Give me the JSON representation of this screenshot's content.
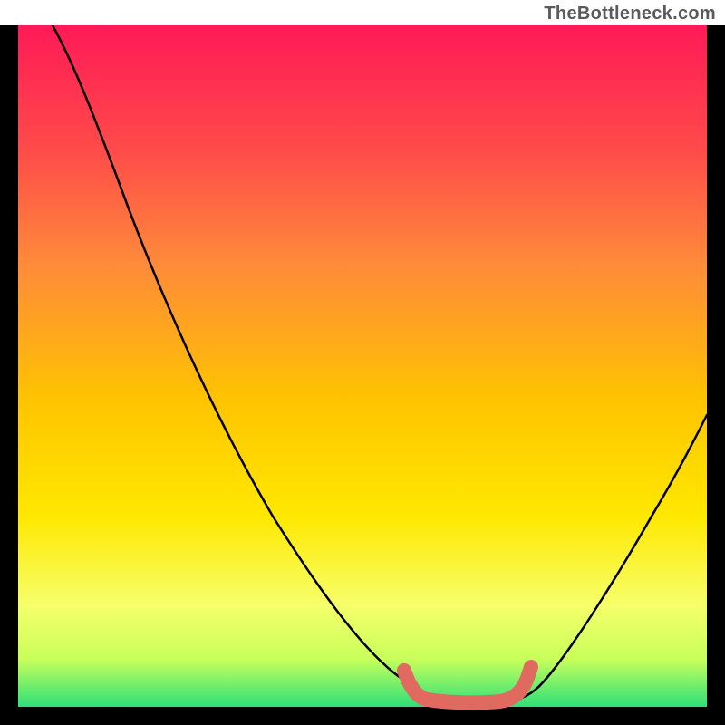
{
  "attribution": "TheBottleneck.com",
  "chart_data": {
    "type": "line",
    "title": "",
    "xlabel": "",
    "ylabel": "",
    "xlim": [
      0,
      100
    ],
    "ylim": [
      0,
      100
    ],
    "grid": false,
    "legend": false,
    "background_gradient": {
      "top_color": "#ff1a57",
      "mid_colors": [
        "#ff6b3d",
        "#ffc400",
        "#ffe800",
        "#ecff4a"
      ],
      "bottom_color": "#2de07a"
    },
    "series": [
      {
        "name": "bottleneck-curve",
        "type": "line",
        "color": "#000000",
        "x": [
          5,
          10,
          15,
          20,
          25,
          30,
          35,
          40,
          45,
          50,
          55,
          58,
          60,
          65,
          70,
          72,
          75,
          80,
          85,
          90,
          95,
          100
        ],
        "y": [
          100,
          90,
          82,
          74,
          66,
          58,
          50,
          42,
          34,
          26,
          17,
          10,
          6,
          3,
          2,
          2,
          3,
          6,
          13,
          22,
          33,
          45
        ]
      },
      {
        "name": "optimal-region-marker",
        "type": "line",
        "color": "#e06a5f",
        "thickness": 16,
        "x": [
          56,
          58,
          60,
          63,
          66,
          69,
          71,
          72
        ],
        "y": [
          8,
          4,
          2.5,
          2,
          2,
          2.5,
          4,
          7
        ]
      }
    ],
    "notes": "No axis tick labels are shown in the image; values estimated from plot geometry. Chart depicts a bottleneck valley on a red-to-green vertical gradient, minimum (optimal) region highlighted in salmon."
  }
}
